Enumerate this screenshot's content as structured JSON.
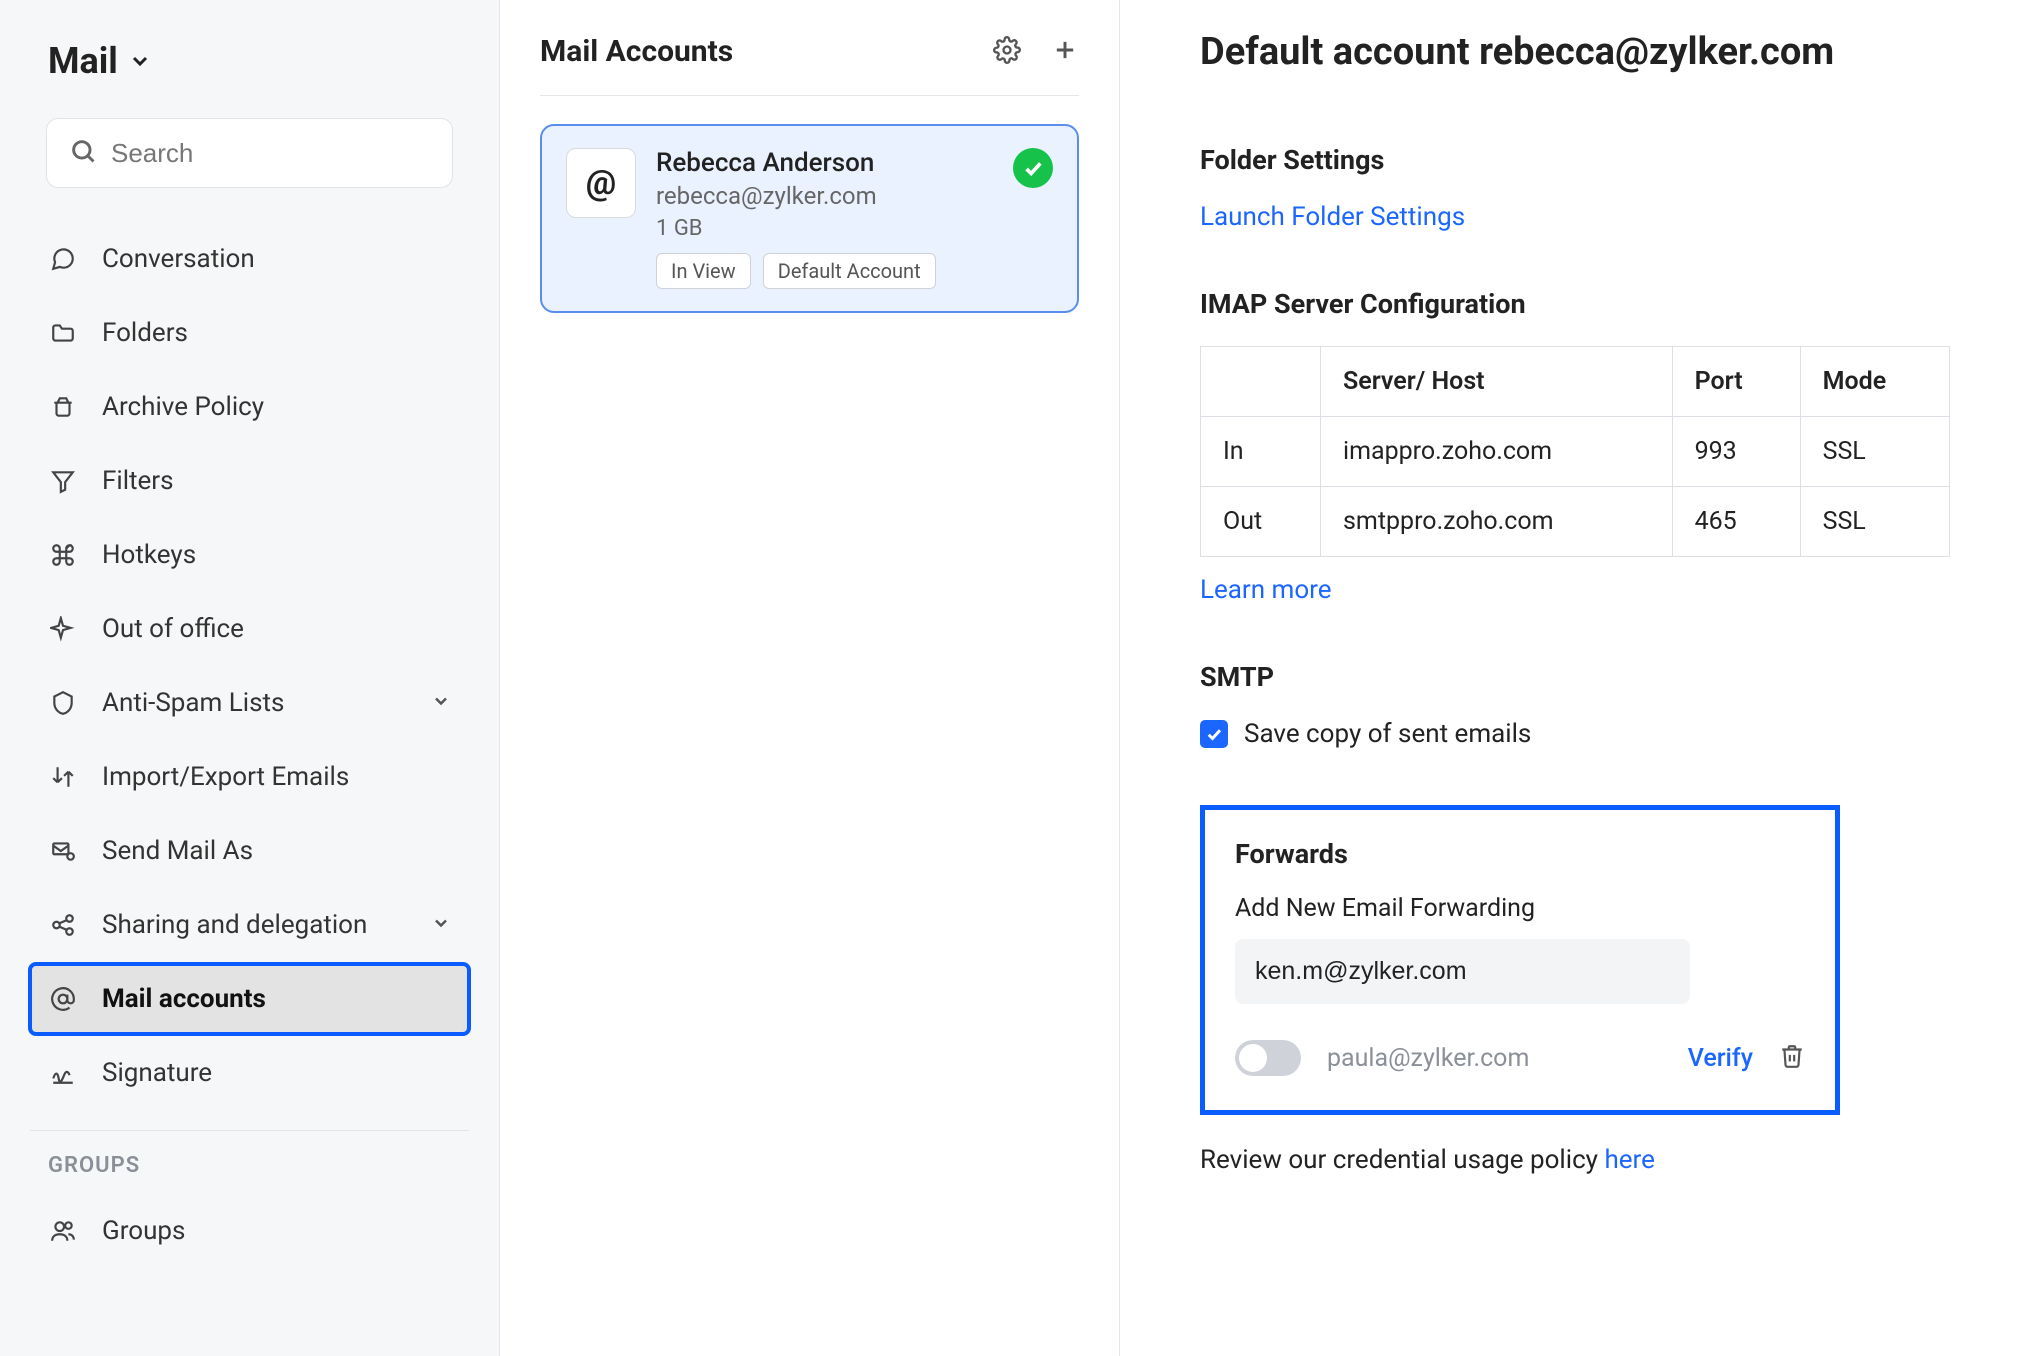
{
  "sidebar": {
    "title": "Mail",
    "search_placeholder": "Search",
    "items": [
      {
        "icon": "chat",
        "label": "Conversation"
      },
      {
        "icon": "folder",
        "label": "Folders"
      },
      {
        "icon": "archive",
        "label": "Archive Policy"
      },
      {
        "icon": "filter",
        "label": "Filters"
      },
      {
        "icon": "command",
        "label": "Hotkeys"
      },
      {
        "icon": "plane",
        "label": "Out of office"
      },
      {
        "icon": "shield",
        "label": "Anti-Spam Lists",
        "expandable": true
      },
      {
        "icon": "swap",
        "label": "Import/Export Emails"
      },
      {
        "icon": "sendas",
        "label": "Send Mail As"
      },
      {
        "icon": "share",
        "label": "Sharing and delegation",
        "expandable": true
      },
      {
        "icon": "at",
        "label": "Mail accounts",
        "active": true
      },
      {
        "icon": "sign",
        "label": "Signature"
      }
    ],
    "groups_label": "GROUPS",
    "groups_item": "Groups"
  },
  "middle": {
    "title": "Mail Accounts",
    "account": {
      "name": "Rebecca Anderson",
      "email": "rebecca@zylker.com",
      "size": "1 GB",
      "badges": [
        "In View",
        "Default Account"
      ]
    }
  },
  "detail": {
    "title": "Default account rebecca@zylker.com",
    "folder_settings_heading": "Folder Settings",
    "launch_folder_settings": "Launch Folder Settings",
    "imap_heading": "IMAP Server Configuration",
    "table_headers": [
      "",
      "Server/ Host",
      "Port",
      "Mode"
    ],
    "table_rows": [
      {
        "dir": "In",
        "host": "imappro.zoho.com",
        "port": "993",
        "mode": "SSL"
      },
      {
        "dir": "Out",
        "host": "smtppro.zoho.com",
        "port": "465",
        "mode": "SSL"
      }
    ],
    "learn_more": "Learn more",
    "smtp_heading": "SMTP",
    "smtp_save_copy": "Save copy of sent emails",
    "forwards_heading": "Forwards",
    "add_forwarding_label": "Add New Email Forwarding",
    "new_forward_value": "ken.m@zylker.com",
    "pending_forward": "paula@zylker.com",
    "verify_label": "Verify",
    "policy_prefix": "Review our credential usage policy ",
    "policy_link": "here"
  }
}
